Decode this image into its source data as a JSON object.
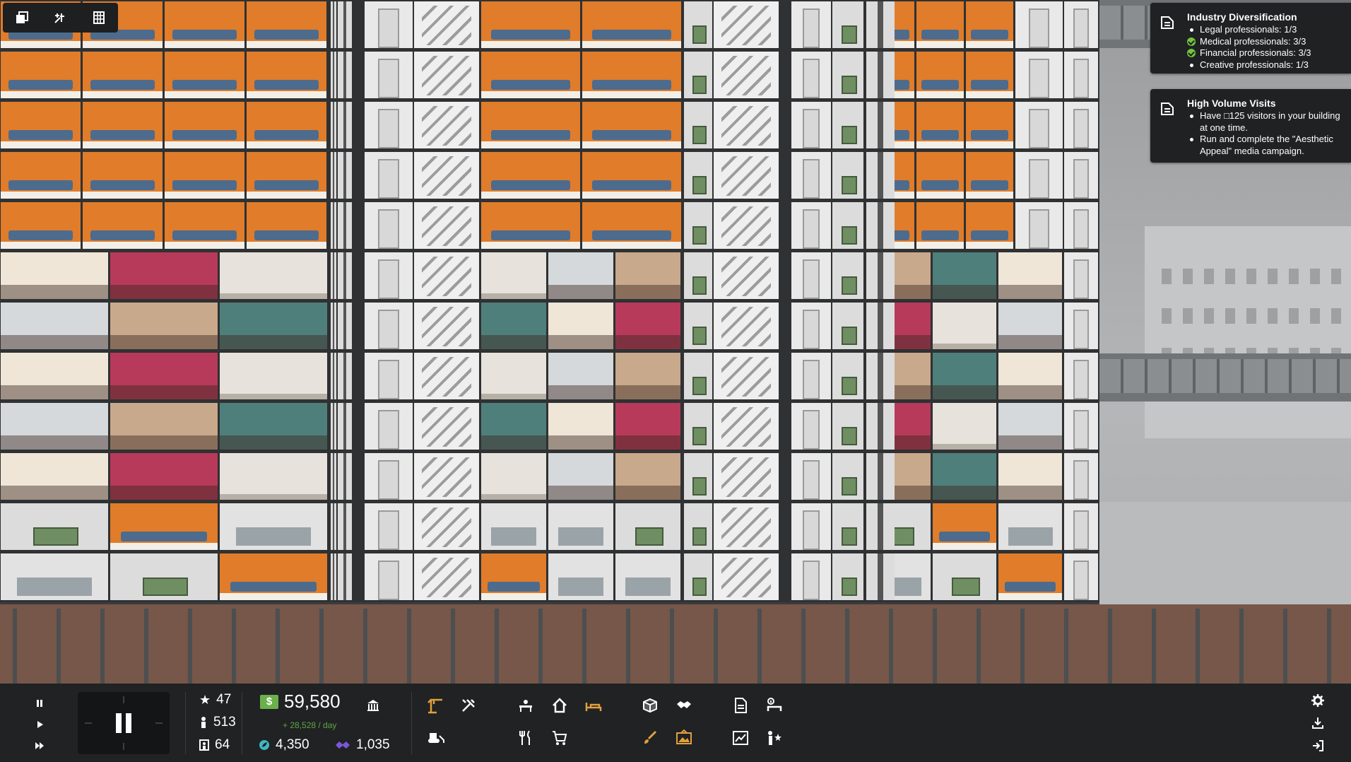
{
  "toolbar": {
    "buttons": [
      {
        "icon": "layers-icon"
      },
      {
        "icon": "build-tools-icon"
      },
      {
        "icon": "building-overview-icon"
      }
    ]
  },
  "objectives": [
    {
      "title": "Industry Diversification",
      "items": [
        {
          "text": "Legal professionals: 1/3",
          "done": false
        },
        {
          "text": "Medical professionals: 3/3",
          "done": true
        },
        {
          "text": "Financial professionals: 3/3",
          "done": true
        },
        {
          "text": "Creative professionals: 1/3",
          "done": false
        }
      ]
    },
    {
      "title": "High Volume Visits",
      "items": [
        {
          "text": "Have □125 visitors in your building at one time.",
          "done": false
        },
        {
          "text": "Run and complete the \"Aesthetic Appeal\" media campaign.",
          "done": false
        }
      ]
    }
  ],
  "hud": {
    "stars": "47",
    "population": "513",
    "visitors": "64",
    "money": "59,580",
    "money_currency_icon": "$",
    "income": "+ 28,528 / day",
    "eco": "4,350",
    "influence": "1,035"
  },
  "colors": {
    "hud_bg": "#202224",
    "accent_orange": "#e2a03a",
    "money_green": "#6bb04a",
    "income_green": "#5fa644",
    "eco_teal": "#3fb7c4",
    "influence_purple": "#7b57d6",
    "apartment_orange": "#e07c2a"
  }
}
